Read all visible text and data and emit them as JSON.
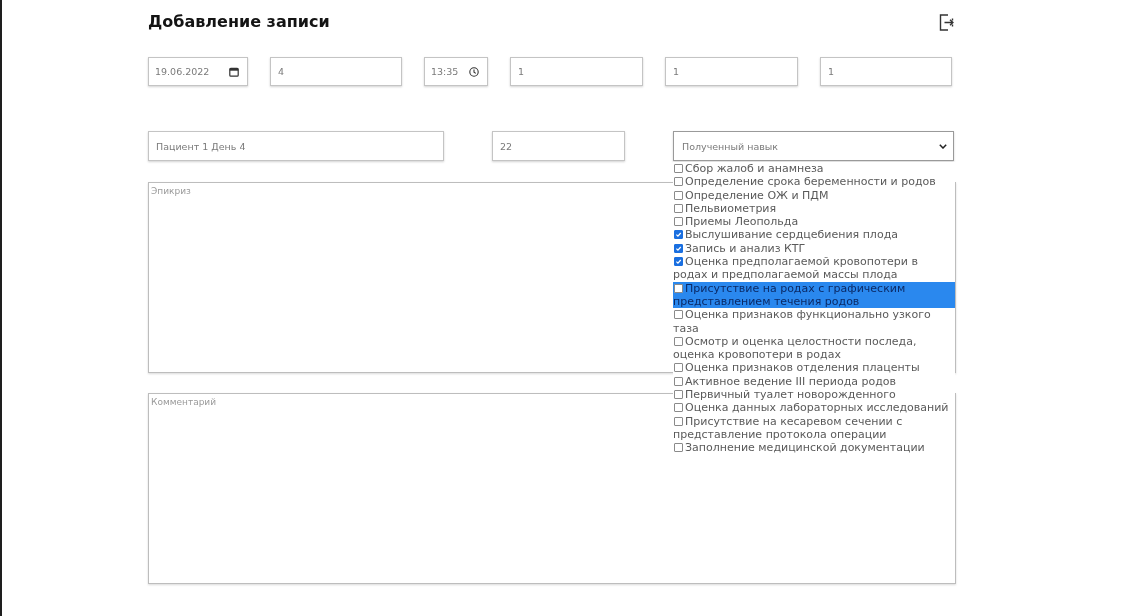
{
  "header": {
    "title": "Добавление записи"
  },
  "fields_row_1": [
    {
      "kind": "date",
      "value": "19.06.2022"
    },
    {
      "kind": "text",
      "value": "4"
    },
    {
      "kind": "time",
      "value": "13:35"
    },
    {
      "kind": "text",
      "value": "1"
    },
    {
      "kind": "text",
      "value": "1"
    },
    {
      "kind": "text",
      "value": "1"
    }
  ],
  "fields_row_2": [
    {
      "kind": "text",
      "value": "Пациент 1 День 4"
    },
    {
      "kind": "text",
      "value": "22"
    },
    {
      "kind": "select",
      "value": "Полученный навык",
      "expanded": true,
      "options": [
        {
          "label": "Сбор жалоб и анамнеза",
          "checked": false,
          "selected": false
        },
        {
          "label": "Определение срока беременности и родов",
          "checked": false,
          "selected": false
        },
        {
          "label": "Определение ОЖ и ПДМ",
          "checked": false,
          "selected": false
        },
        {
          "label": "Пельвиометрия",
          "checked": false,
          "selected": false
        },
        {
          "label": "Приемы Леопольда",
          "checked": false,
          "selected": false
        },
        {
          "label": "Выслушивание сердцебиения плода",
          "checked": true,
          "selected": false
        },
        {
          "label": "Запись и анализ КТГ",
          "checked": true,
          "selected": false
        },
        {
          "label": "Оценка предполагаемой кровопотери в родах и предполагаемой массы плода",
          "checked": true,
          "selected": false
        },
        {
          "label": "Присутствие на родах с графическим представлением течения родов",
          "checked": false,
          "selected": true
        },
        {
          "label": "Оценка признаков функционально узкого таза",
          "checked": false,
          "selected": false
        },
        {
          "label": "Осмотр и оценка целостности последа, оценка кровопотери в родах",
          "checked": false,
          "selected": false
        },
        {
          "label": "Оценка признаков отделения плаценты",
          "checked": false,
          "selected": false
        },
        {
          "label": "Активное ведение III периода родов",
          "checked": false,
          "selected": false
        },
        {
          "label": "Первичный туалет новорожденного",
          "checked": false,
          "selected": false
        },
        {
          "label": "Оценка данных лабораторных исследований",
          "checked": false,
          "selected": false
        },
        {
          "label": "Присутствие на кесаревом сечении с представление протокола операции",
          "checked": false,
          "selected": false
        },
        {
          "label": "Заполнение медицинской документации",
          "checked": false,
          "selected": false
        }
      ]
    }
  ],
  "text_areas": [
    {
      "placeholder": "Эпикриз"
    },
    {
      "placeholder": "Комментарий"
    }
  ]
}
